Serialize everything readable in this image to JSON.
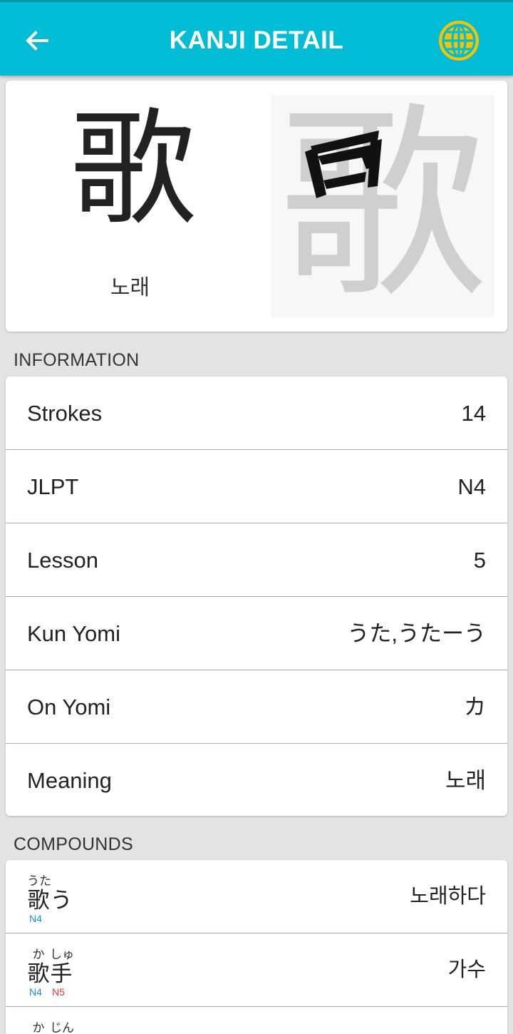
{
  "appbar": {
    "title": "KANJI DETAIL",
    "back_icon": "arrow-left-icon",
    "globe_icon": "globe-icon",
    "globe_color": "#f5c400",
    "color": "#00bcd4"
  },
  "kanji": {
    "character": "歌",
    "meaning": "노래"
  },
  "information": {
    "section_label": "INFORMATION",
    "rows": [
      {
        "label": "Strokes",
        "value": "14"
      },
      {
        "label": "JLPT",
        "value": "N4"
      },
      {
        "label": "Lesson",
        "value": "5"
      },
      {
        "label": "Kun Yomi",
        "value": "うた,うたーう"
      },
      {
        "label": "On Yomi",
        "value": "カ"
      },
      {
        "label": "Meaning",
        "value": "노래"
      }
    ]
  },
  "compounds": {
    "section_label": "COMPOUNDS",
    "items": [
      {
        "chars": [
          {
            "furigana": "うた",
            "char": "歌",
            "level": "N4"
          },
          {
            "furigana": "",
            "char": "う",
            "level": ""
          }
        ],
        "meaning": "노래하다"
      },
      {
        "chars": [
          {
            "furigana": "か",
            "char": "歌",
            "level": "N4"
          },
          {
            "furigana": "しゅ",
            "char": "手",
            "level": "N5"
          }
        ],
        "meaning": "가수"
      },
      {
        "chars": [
          {
            "furigana": "か",
            "char": "",
            "level": ""
          },
          {
            "furigana": "じん",
            "char": "",
            "level": ""
          }
        ],
        "meaning": ""
      }
    ]
  }
}
